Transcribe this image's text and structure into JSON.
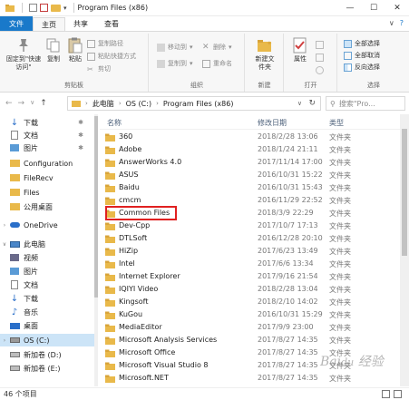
{
  "titlebar": {
    "title": "Program Files (x86)"
  },
  "ribbon_tabs": {
    "file": "文件",
    "home": "主页",
    "share": "共享",
    "view": "查看"
  },
  "ribbon": {
    "clipboard": {
      "pin": "固定到\"快速访问\"",
      "copy": "复制",
      "paste": "粘贴",
      "copy_path": "复制路径",
      "paste_shortcut": "粘贴快捷方式",
      "cut": "剪切",
      "label": "剪贴板"
    },
    "organize": {
      "move_to": "移动到",
      "copy_to": "复制到",
      "delete": "删除",
      "rename": "重命名",
      "label": "组织"
    },
    "new": {
      "new_folder": "新建文件夹",
      "label": "新建"
    },
    "open": {
      "properties": "属性",
      "label": "打开"
    },
    "select": {
      "select_all": "全部选择",
      "select_none": "全部取消",
      "invert": "反向选择",
      "label": "选择"
    }
  },
  "address": {
    "root": "此电脑",
    "drive": "OS (C:)",
    "folder": "Program Files (x86)"
  },
  "search": {
    "placeholder": "搜索\"Pro..."
  },
  "nav": {
    "items": [
      {
        "label": "下载",
        "pinned": true
      },
      {
        "label": "文档",
        "pinned": true
      },
      {
        "label": "图片",
        "pinned": true
      },
      {
        "label": "Configuration"
      },
      {
        "label": "FileRecv"
      },
      {
        "label": "Files"
      },
      {
        "label": "公用桌面"
      },
      {
        "label": "OneDrive"
      },
      {
        "label": "此电脑"
      },
      {
        "label": "视频"
      },
      {
        "label": "图片"
      },
      {
        "label": "文档"
      },
      {
        "label": "下载"
      },
      {
        "label": "音乐"
      },
      {
        "label": "桌面"
      },
      {
        "label": "OS (C:)"
      },
      {
        "label": "新加卷 (D:)"
      },
      {
        "label": "新加卷 (E:)"
      }
    ]
  },
  "columns": {
    "name": "名称",
    "date": "修改日期",
    "type": "类型"
  },
  "files": [
    {
      "name": "360",
      "date": "2018/2/28 13:06",
      "type": "文件夹"
    },
    {
      "name": "Adobe",
      "date": "2018/1/24 21:11",
      "type": "文件夹"
    },
    {
      "name": "AnswerWorks 4.0",
      "date": "2017/11/14 17:00",
      "type": "文件夹"
    },
    {
      "name": "ASUS",
      "date": "2016/10/31 15:22",
      "type": "文件夹"
    },
    {
      "name": "Baidu",
      "date": "2016/10/31 15:43",
      "type": "文件夹"
    },
    {
      "name": "cmcm",
      "date": "2016/11/29 22:52",
      "type": "文件夹"
    },
    {
      "name": "Common Files",
      "date": "2018/3/9 22:29",
      "type": "文件夹"
    },
    {
      "name": "Dev-Cpp",
      "date": "2017/10/7 17:13",
      "type": "文件夹"
    },
    {
      "name": "DTLSoft",
      "date": "2016/12/28 20:10",
      "type": "文件夹"
    },
    {
      "name": "HiZip",
      "date": "2017/6/23 13:49",
      "type": "文件夹"
    },
    {
      "name": "Intel",
      "date": "2017/6/6 13:34",
      "type": "文件夹"
    },
    {
      "name": "Internet Explorer",
      "date": "2017/9/16 21:54",
      "type": "文件夹"
    },
    {
      "name": "IQIYI Video",
      "date": "2018/2/28 13:04",
      "type": "文件夹"
    },
    {
      "name": "Kingsoft",
      "date": "2018/2/10 14:02",
      "type": "文件夹"
    },
    {
      "name": "KuGou",
      "date": "2016/10/31 15:29",
      "type": "文件夹"
    },
    {
      "name": "MediaEditor",
      "date": "2017/9/9 23:00",
      "type": "文件夹"
    },
    {
      "name": "Microsoft Analysis Services",
      "date": "2017/8/27 14:35",
      "type": "文件夹"
    },
    {
      "name": "Microsoft Office",
      "date": "2017/8/27 14:35",
      "type": "文件夹"
    },
    {
      "name": "Microsoft Visual Studio 8",
      "date": "2017/8/27 14:35",
      "type": "文件夹"
    },
    {
      "name": "Microsoft.NET",
      "date": "2017/8/27 14:35",
      "type": "文件夹"
    }
  ],
  "status": {
    "count": "46 个项目"
  },
  "watermark": "Baidu 经验",
  "colors": {
    "accent": "#1979ca",
    "folder": "#e9b94a",
    "highlight": "#e02020",
    "selected": "#cce4f7"
  }
}
